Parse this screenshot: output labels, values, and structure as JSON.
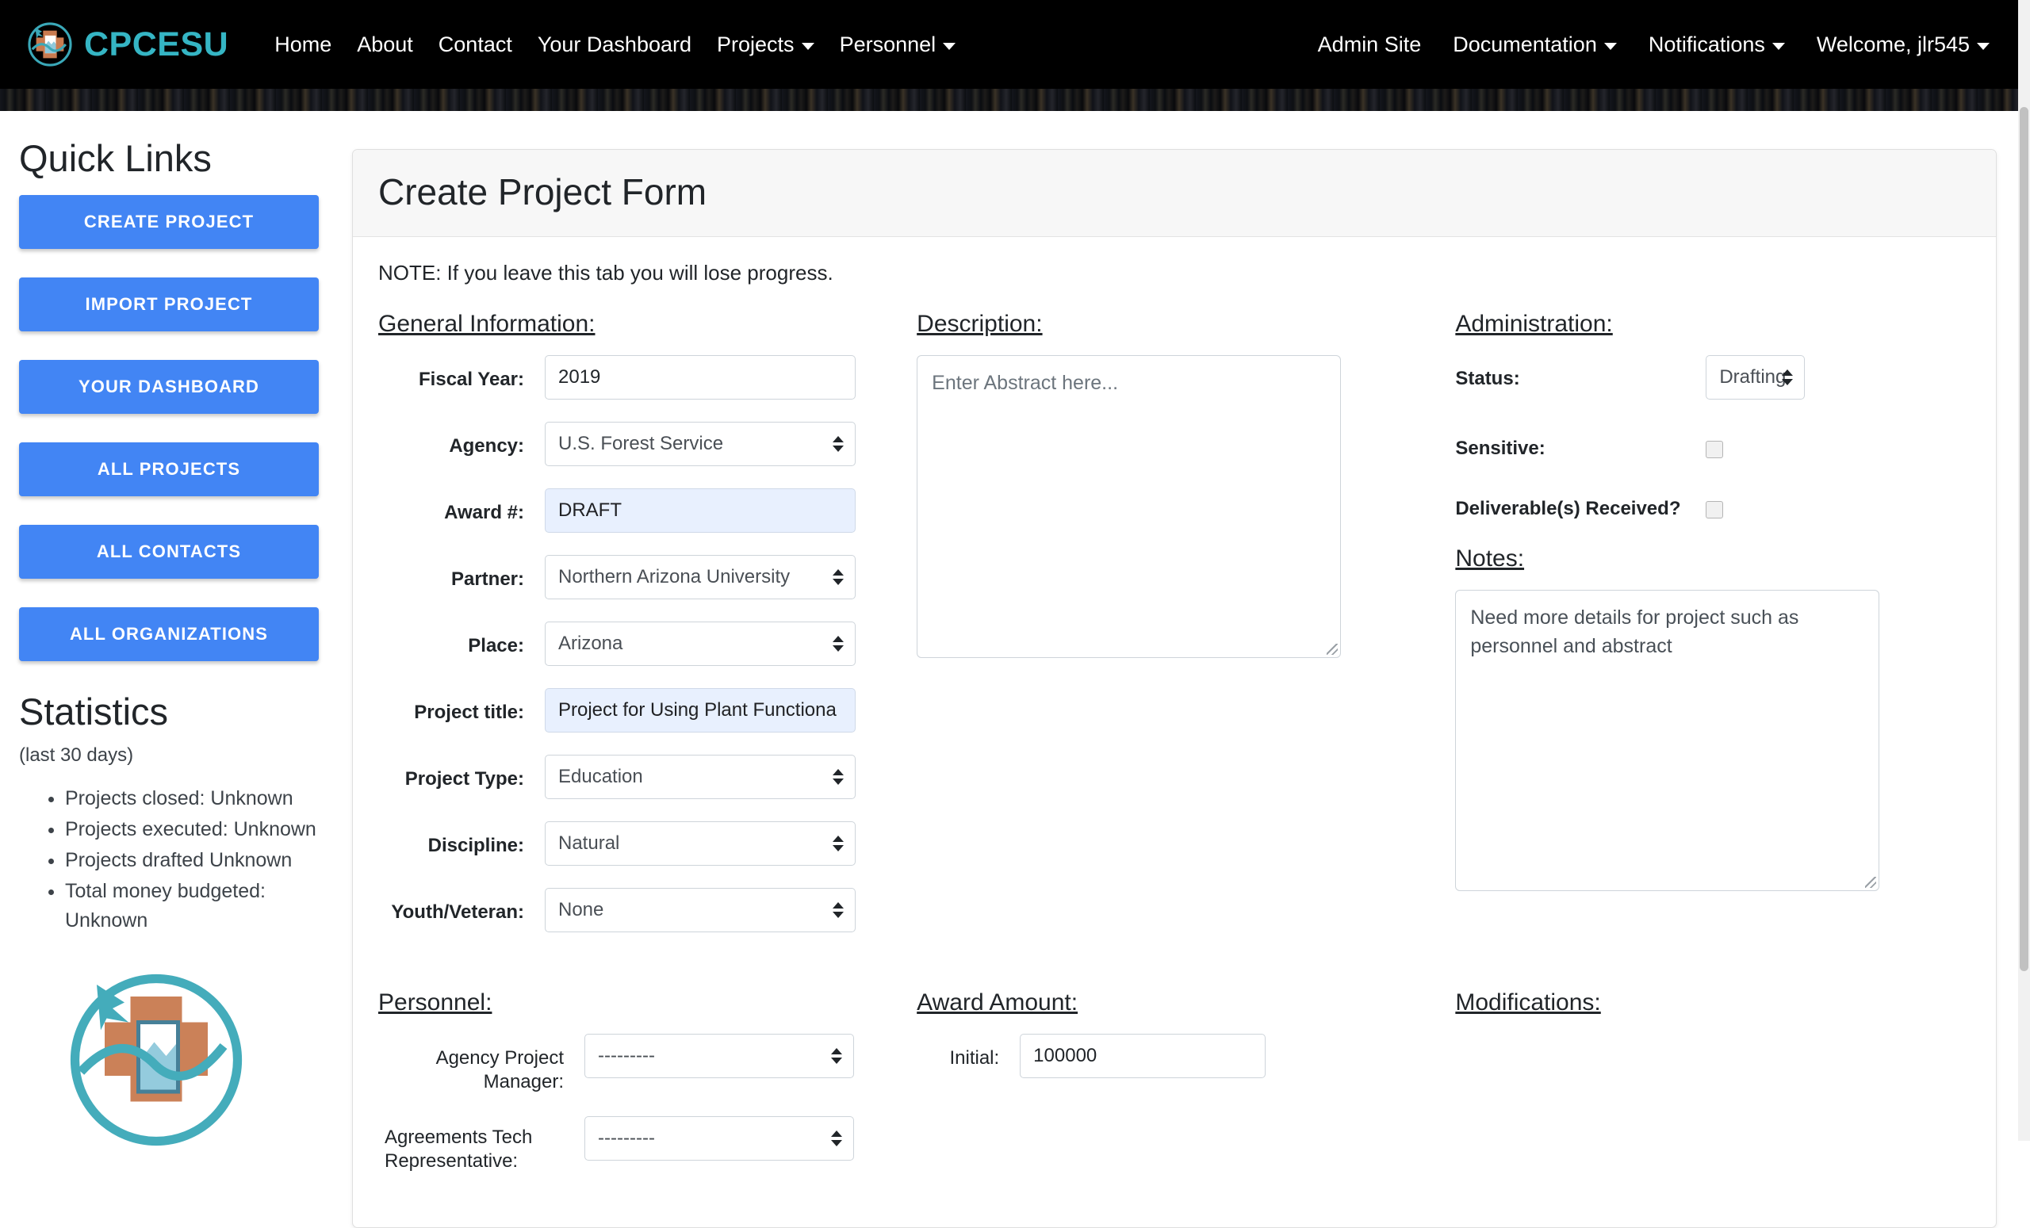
{
  "navbar": {
    "brand": {
      "text": "CPCESU",
      "logo_icon": "cpcesu-logo-icon",
      "accent_color": "#35b5c4"
    },
    "left_items": [
      {
        "label": "Home",
        "has_caret": false
      },
      {
        "label": "About",
        "has_caret": false
      },
      {
        "label": "Contact",
        "has_caret": false
      },
      {
        "label": "Your Dashboard",
        "has_caret": false
      },
      {
        "label": "Projects",
        "has_caret": true
      },
      {
        "label": "Personnel",
        "has_caret": true
      }
    ],
    "right_items": [
      {
        "label": "Admin Site",
        "has_caret": false
      },
      {
        "label": "Documentation",
        "has_caret": true
      },
      {
        "label": "Notifications",
        "has_caret": true
      },
      {
        "label": "Welcome, jlr545",
        "has_caret": true
      }
    ]
  },
  "sidebar": {
    "quick_links_title": "Quick Links",
    "buttons": [
      "CREATE PROJECT",
      "IMPORT PROJECT",
      "YOUR DASHBOARD",
      "ALL PROJECTS",
      "ALL CONTACTS",
      "ALL ORGANIZATIONS"
    ],
    "statistics": {
      "title": "Statistics",
      "subtitle": "(last 30 days)",
      "items": [
        "Projects closed: Unknown",
        "Projects executed: Unknown",
        "Projects drafted Unknown",
        "Total money budgeted: Unknown"
      ]
    }
  },
  "form": {
    "card_title": "Create Project Form",
    "note": "NOTE: If you leave this tab you will lose progress.",
    "general": {
      "title": "General Information:",
      "fields": [
        {
          "label": "Fiscal Year:",
          "value": "2019",
          "type": "text",
          "autofill": false
        },
        {
          "label": "Agency:",
          "value": "U.S. Forest Service",
          "type": "select",
          "autofill": false
        },
        {
          "label": "Award #:",
          "value": "DRAFT",
          "type": "text",
          "autofill": true
        },
        {
          "label": "Partner:",
          "value": "Northern Arizona University",
          "type": "select",
          "autofill": false
        },
        {
          "label": "Place:",
          "value": "Arizona",
          "type": "select",
          "autofill": false
        },
        {
          "label": "Project title:",
          "value": "Project for Using Plant Functiona",
          "type": "text",
          "autofill": true
        },
        {
          "label": "Project Type:",
          "value": "Education",
          "type": "select",
          "autofill": false
        },
        {
          "label": "Discipline:",
          "value": "Natural",
          "type": "select",
          "autofill": false
        },
        {
          "label": "Youth/Veteran:",
          "value": "None",
          "type": "select",
          "autofill": false
        }
      ]
    },
    "description": {
      "title": "Description:",
      "placeholder": "Enter Abstract here...",
      "value": ""
    },
    "administration": {
      "title": "Administration:",
      "status_label": "Status:",
      "status_value": "Drafting",
      "sensitive_label": "Sensitive:",
      "sensitive_checked": false,
      "deliverables_label": "Deliverable(s) Received?",
      "deliverables_checked": false
    },
    "notes": {
      "title": "Notes:",
      "value": "Need more details for project such as personnel and abstract"
    },
    "personnel": {
      "title": "Personnel:",
      "fields": [
        {
          "label": "Agency Project Manager:",
          "value": "---------"
        },
        {
          "label": "Agreements Tech Representative:",
          "value": "---------"
        }
      ]
    },
    "award_amount": {
      "title": "Award Amount:",
      "initial_label": "Initial:",
      "initial_value": "100000"
    },
    "modifications": {
      "title": "Modifications:"
    }
  },
  "colors": {
    "navbar_bg": "#000000",
    "brand_teal": "#35b5c4",
    "button_blue": "#4285f4",
    "autofill_blue": "#e8f0fe",
    "card_header": "#f7f7f7"
  }
}
